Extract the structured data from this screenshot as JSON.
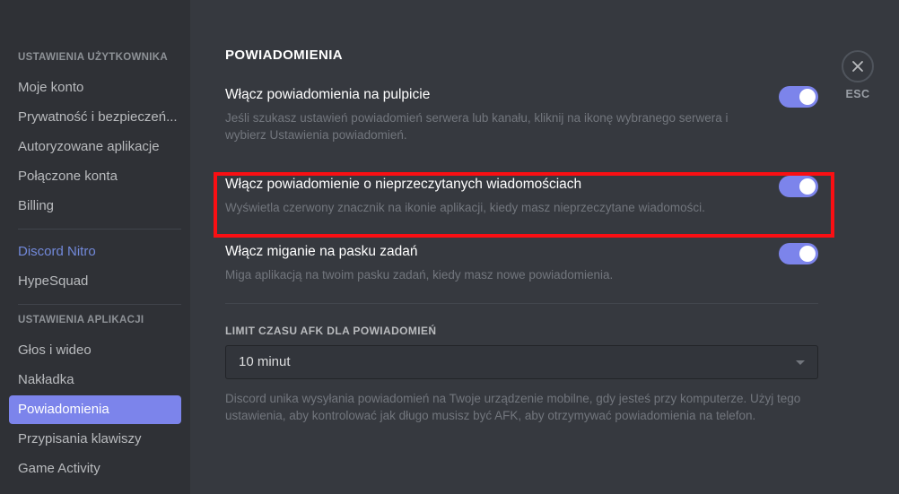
{
  "sidebar": {
    "user_section_header": "USTAWIENIA UŻYTKOWNIKA",
    "user_items": [
      {
        "label": "Moje konto"
      },
      {
        "label": "Prywatność i bezpieczeń..."
      },
      {
        "label": "Autoryzowane aplikacje"
      },
      {
        "label": "Połączone konta"
      },
      {
        "label": "Billing"
      }
    ],
    "promo_items": [
      {
        "label": "Discord Nitro"
      },
      {
        "label": "HypeSquad"
      }
    ],
    "app_section_header": "USTAWIENIA APLIKACJI",
    "app_items": [
      {
        "label": "Głos i wideo"
      },
      {
        "label": "Nakładka"
      },
      {
        "label": "Powiadomienia"
      },
      {
        "label": "Przypisania klawiszy"
      },
      {
        "label": "Game Activity"
      }
    ],
    "active_label": "Powiadomienia",
    "active_color": "#7c84eb",
    "nitro_color": "#7289da"
  },
  "main": {
    "title": "POWIADOMIENIA",
    "settings": [
      {
        "title": "Włącz powiadomienia na pulpicie",
        "description": "Jeśli szukasz ustawień powiadomień serwera lub kanału, kliknij na ikonę wybranego serwera i wybierz Ustawienia powiadomień.",
        "toggle_state": "on"
      },
      {
        "title": "Włącz powiadomienie o nieprzeczytanych wiadomościach",
        "description": "Wyświetla czerwony znacznik na ikonie aplikacji, kiedy masz nieprzeczytane wiadomości.",
        "toggle_state": "on"
      },
      {
        "title": "Włącz miganie na pasku zadań",
        "description": "Miga aplikacją na twoim pasku zadań, kiedy masz nowe powiadomienia.",
        "toggle_state": "on"
      }
    ],
    "afk": {
      "label": "LIMIT CZASU AFK DLA POWIADOMIEŃ",
      "selected_value": "10 minut",
      "help_text": "Discord unika wysyłania powiadomień na Twoje urządzenie mobilne, gdy jesteś przy komputerze. Użyj tego ustawienia, aby kontrolować jak długo musisz być AFK, aby otrzymywać powiadomienia na telefon."
    }
  },
  "close": {
    "label": "ESC",
    "icon": "close-icon"
  },
  "annotation": {
    "highlight_color": "#fa0f13",
    "highlights": "Włącz powiadomienie o nieprzeczytanych wiadomościach"
  }
}
